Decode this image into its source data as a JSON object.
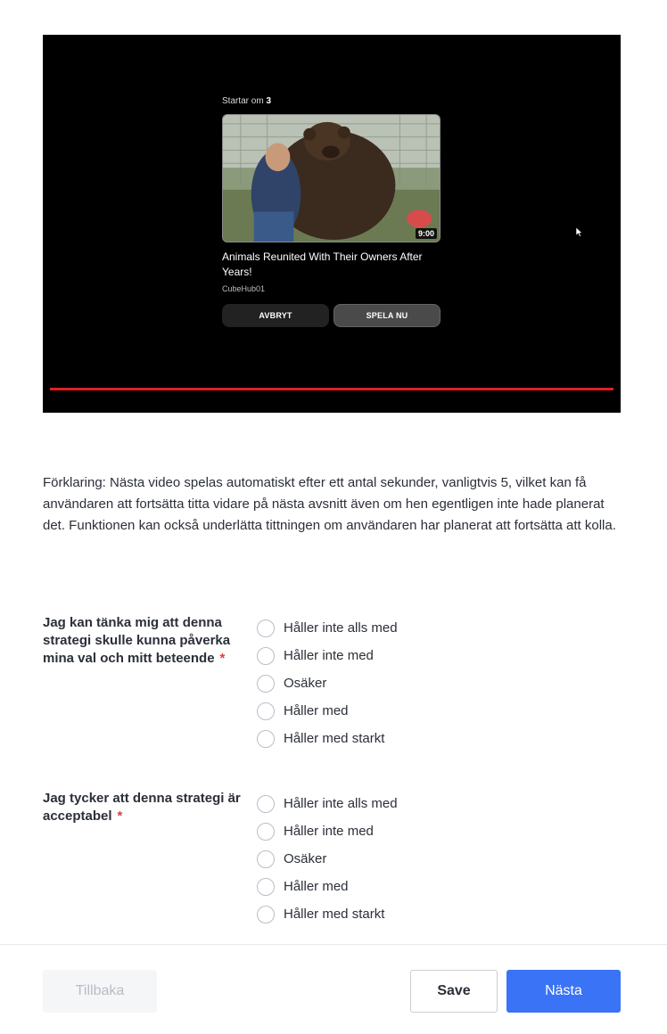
{
  "video": {
    "starts_in_label": "Startar om",
    "starts_in_count": "3",
    "duration": "9:00",
    "title": "Animals Reunited With Their Owners After Years!",
    "channel": "CubeHub01",
    "cancel_label": "AVBRYT",
    "play_label": "SPELA NU",
    "progress_color": "#e02020"
  },
  "explanation": "Förklaring: Nästa video spelas automatiskt efter ett antal sekunder, vanligtvis 5, vilket kan få användaren att fortsätta titta vidare på nästa avsnitt även om hen egentligen inte hade planerat det. Funktionen kan också underlätta tittningen om användaren har planerat att fortsätta att kolla.",
  "questions": [
    {
      "label": "Jag kan tänka mig att denna strategi skulle kunna påverka mina val och mitt beteende",
      "required_mark": "*",
      "options": [
        "Håller inte alls med",
        "Håller inte med",
        "Osäker",
        "Håller med",
        "Håller med starkt"
      ]
    },
    {
      "label": "Jag tycker att denna strategi är acceptabel",
      "required_mark": "*",
      "options": [
        "Håller inte alls med",
        "Håller inte med",
        "Osäker",
        "Håller med",
        "Håller med starkt"
      ]
    }
  ],
  "footer": {
    "back_label": "Tillbaka",
    "save_label": "Save",
    "next_label": "Nästa"
  },
  "colors": {
    "primary": "#3a73f5",
    "required": "#e53935"
  }
}
